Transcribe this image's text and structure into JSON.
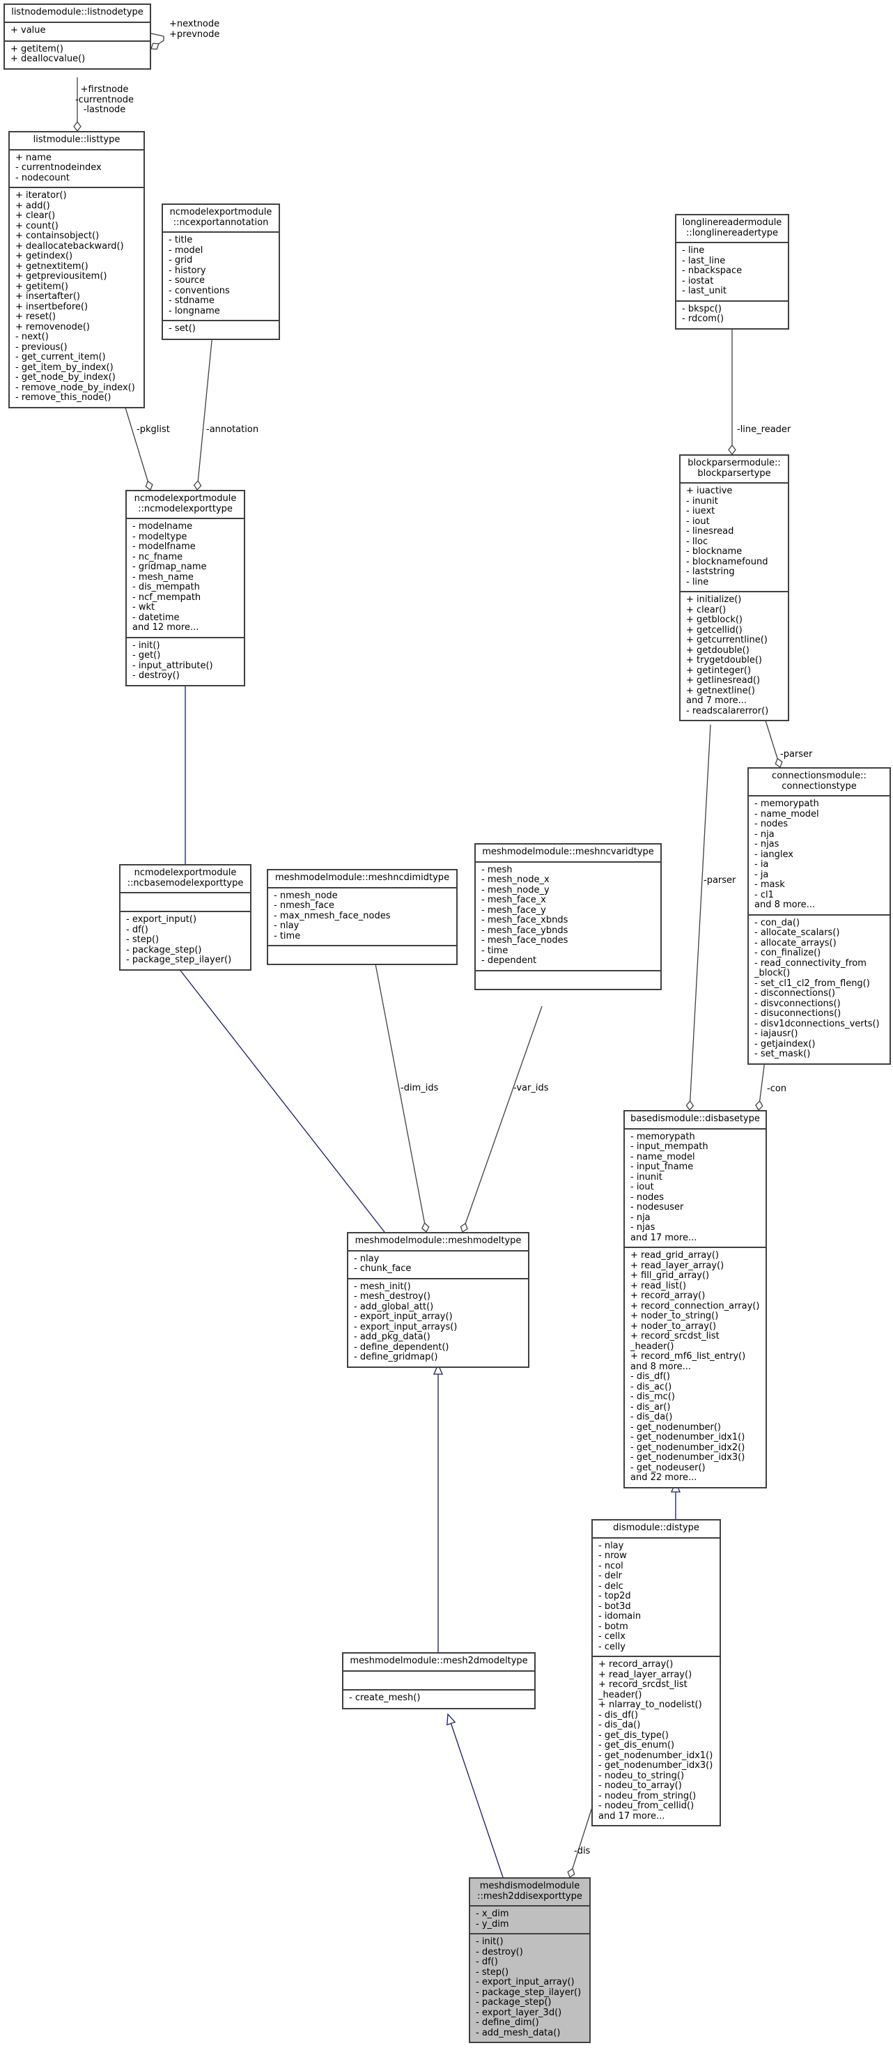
{
  "diagram": {
    "type": "uml-class-collaboration",
    "colors": {
      "association": "#404040",
      "inheritance": "#191970",
      "focus_fill": "#bfbfbf"
    },
    "classes": [
      {
        "id": "listnodetype",
        "title": "listnodemodule::listnodetype",
        "attributes": [
          "+ value"
        ],
        "methods": [
          "+ getitem()",
          "+ deallocvalue()"
        ]
      },
      {
        "id": "listtype",
        "title": "listmodule::listtype",
        "attributes": [
          "+ name",
          "- currentnodeindex",
          "- nodecount"
        ],
        "methods": [
          "+ iterator()",
          "+ add()",
          "+ clear()",
          "+ count()",
          "+ containsobject()",
          "+ deallocatebackward()",
          "+ getindex()",
          "+ getnextitem()",
          "+ getpreviousitem()",
          "+ getitem()",
          "+ insertafter()",
          "+ insertbefore()",
          "+ reset()",
          "+ removenode()",
          "- next()",
          "- previous()",
          "- get_current_item()",
          "- get_item_by_index()",
          "- get_node_by_index()",
          "- remove_node_by_index()",
          "- remove_this_node()"
        ]
      },
      {
        "id": "ncexportannotation",
        "title": "ncmodelexportmodule\n::ncexportannotation",
        "attributes": [
          "- title",
          "- model",
          "- grid",
          "- history",
          "- source",
          "- conventions",
          "- stdname",
          "- longname"
        ],
        "methods": [
          "- set()"
        ]
      },
      {
        "id": "longlinereadertype",
        "title": "longlinereadermodule\n::longlinereadertype",
        "attributes": [
          "- line",
          "- last_line",
          "- nbackspace",
          "- iostat",
          "- last_unit"
        ],
        "methods": [
          "- bkspc()",
          "- rdcom()"
        ]
      },
      {
        "id": "ncmodelexporttype",
        "title": "ncmodelexportmodule\n::ncmodelexporttype",
        "attributes": [
          "- modelname",
          "- modeltype",
          "- modelfname",
          "- nc_fname",
          "- gridmap_name",
          "- mesh_name",
          "- dis_mempath",
          "- ncf_mempath",
          "- wkt",
          "- datetime",
          "and 12 more..."
        ],
        "methods": [
          "- init()",
          "- get()",
          "- input_attribute()",
          "- destroy()"
        ]
      },
      {
        "id": "blockparsertype",
        "title": "blockparsermodule::\nblockparsertype",
        "attributes": [
          "+ iuactive",
          "- inunit",
          "- iuext",
          "- iout",
          "- linesread",
          "- lloc",
          "- blockname",
          "- blocknamefound",
          "- laststring",
          "- line"
        ],
        "methods": [
          "+ initialize()",
          "+ clear()",
          "+ getblock()",
          "+ getcellid()",
          "+ getcurrentline()",
          "+ getdouble()",
          "+ trygetdouble()",
          "+ getinteger()",
          "+ getlinesread()",
          "+ getnextline()",
          "and 7 more...",
          "- readscalarerror()"
        ]
      },
      {
        "id": "connectionstype",
        "title": "connectionsmodule::\nconnectionstype",
        "attributes": [
          "- memorypath",
          "- name_model",
          "- nodes",
          "- nja",
          "- njas",
          "- ianglex",
          "- ia",
          "- ja",
          "- mask",
          "- cl1",
          "and 8 more..."
        ],
        "methods": [
          "- con_da()",
          "- allocate_scalars()",
          "- allocate_arrays()",
          "- con_finalize()",
          "- read_connectivity_from\n_block()",
          "- set_cl1_cl2_from_fleng()",
          "- disconnections()",
          "- disvconnections()",
          "- disuconnections()",
          "- disv1dconnections_verts()",
          "- iajausr()",
          "- getjaindex()",
          "- set_mask()"
        ]
      },
      {
        "id": "ncbasemodelexporttype",
        "title": "ncmodelexportmodule\n::ncbasemodelexporttype",
        "attributes": [],
        "methods": [
          "- export_input()",
          "- df()",
          "- step()",
          "- package_step()",
          "- package_step_ilayer()"
        ]
      },
      {
        "id": "meshncdimidtype",
        "title": "meshmodelmodule::meshncdimidtype",
        "attributes": [
          "- nmesh_node",
          "- nmesh_face",
          "- max_nmesh_face_nodes",
          "- nlay",
          "- time"
        ],
        "methods": []
      },
      {
        "id": "meshncvaridtype",
        "title": "meshmodelmodule::meshncvaridtype",
        "attributes": [
          "- mesh",
          "- mesh_node_x",
          "- mesh_node_y",
          "- mesh_face_x",
          "- mesh_face_y",
          "- mesh_face_xbnds",
          "- mesh_face_ybnds",
          "- mesh_face_nodes",
          "- time",
          "- dependent"
        ],
        "methods": []
      },
      {
        "id": "disbasetype",
        "title": "basedismodule::disbasetype",
        "attributes": [
          "- memorypath",
          "- input_mempath",
          "- name_model",
          "- input_fname",
          "- inunit",
          "- iout",
          "- nodes",
          "- nodesuser",
          "- nja",
          "- njas",
          "and 17 more..."
        ],
        "methods": [
          "+ read_grid_array()",
          "+ read_layer_array()",
          "+ fill_grid_array()",
          "+ read_list()",
          "+ record_array()",
          "+ record_connection_array()",
          "+ noder_to_string()",
          "+ noder_to_array()",
          "+ record_srcdst_list\n_header()",
          "+ record_mf6_list_entry()",
          "and 8 more...",
          "- dis_df()",
          "- dis_ac()",
          "- dis_mc()",
          "- dis_ar()",
          "- dis_da()",
          "- get_nodenumber()",
          "- get_nodenumber_idx1()",
          "- get_nodenumber_idx2()",
          "- get_nodenumber_idx3()",
          "- get_nodeuser()",
          "and 22 more..."
        ]
      },
      {
        "id": "meshmodeltype",
        "title": "meshmodelmodule::meshmodeltype",
        "attributes": [
          "- nlay",
          "- chunk_face"
        ],
        "methods": [
          "- mesh_init()",
          "- mesh_destroy()",
          "- add_global_att()",
          "- export_input_array()",
          "- export_input_arrays()",
          "- add_pkg_data()",
          "- define_dependent()",
          "- define_gridmap()"
        ]
      },
      {
        "id": "distype",
        "title": "dismodule::distype",
        "attributes": [
          "- nlay",
          "- nrow",
          "- ncol",
          "- delr",
          "- delc",
          "- top2d",
          "- bot3d",
          "- idomain",
          "- botm",
          "- cellx",
          "- celly"
        ],
        "methods": [
          "+ record_array()",
          "+ read_layer_array()",
          "+ record_srcdst_list\n_header()",
          "+ nlarray_to_nodelist()",
          "- dis_df()",
          "- dis_da()",
          "- get_dis_type()",
          "- get_dis_enum()",
          "- get_nodenumber_idx1()",
          "- get_nodenumber_idx3()",
          "- nodeu_to_string()",
          "- nodeu_to_array()",
          "- nodeu_from_string()",
          "- nodeu_from_cellid()",
          "and 17 more..."
        ]
      },
      {
        "id": "mesh2dmodeltype",
        "title": "meshmodelmodule::mesh2dmodeltype",
        "attributes": [],
        "methods": [
          "- create_mesh()"
        ]
      },
      {
        "id": "mesh2ddisexporttype",
        "title": "meshdismodelmodule\n::mesh2ddisexporttype",
        "focus": true,
        "attributes": [
          "- x_dim",
          "- y_dim"
        ],
        "methods": [
          "- init()",
          "- destroy()",
          "- df()",
          "- step()",
          "- export_input_array()",
          "- package_step_ilayer()",
          "- package_step()",
          "- export_layer_3d()",
          "- define_dim()",
          "- add_mesh_data()"
        ]
      }
    ],
    "relations": [
      {
        "from": "listnodetype",
        "to": "listnodetype",
        "kind": "association",
        "label": "+nextnode\n+prevnode"
      },
      {
        "from": "listnodetype",
        "to": "listtype",
        "kind": "association",
        "label": "+firstnode\n-currentnode\n-lastnode"
      },
      {
        "from": "listtype",
        "to": "ncmodelexporttype",
        "kind": "association",
        "label": "-pkglist"
      },
      {
        "from": "ncexportannotation",
        "to": "ncmodelexporttype",
        "kind": "association",
        "label": "-annotation"
      },
      {
        "from": "longlinereadertype",
        "to": "blockparsertype",
        "kind": "association",
        "label": "-line_reader"
      },
      {
        "from": "ncmodelexporttype",
        "to": "ncbasemodelexporttype",
        "kind": "inheritance",
        "label": ""
      },
      {
        "from": "blockparsertype",
        "to": "connectionstype",
        "kind": "association",
        "label": "-parser"
      },
      {
        "from": "blockparsertype",
        "to": "disbasetype",
        "kind": "association",
        "label": "-parser"
      },
      {
        "from": "connectionstype",
        "to": "disbasetype",
        "kind": "association",
        "label": "-con"
      },
      {
        "from": "ncbasemodelexporttype",
        "to": "meshmodeltype",
        "kind": "inheritance",
        "label": ""
      },
      {
        "from": "meshncdimidtype",
        "to": "meshmodeltype",
        "kind": "association",
        "label": "-dim_ids"
      },
      {
        "from": "meshncvaridtype",
        "to": "meshmodeltype",
        "kind": "association",
        "label": "-var_ids"
      },
      {
        "from": "disbasetype",
        "to": "distype",
        "kind": "inheritance",
        "label": ""
      },
      {
        "from": "meshmodeltype",
        "to": "mesh2dmodeltype",
        "kind": "inheritance",
        "label": ""
      },
      {
        "from": "mesh2dmodeltype",
        "to": "mesh2ddisexporttype",
        "kind": "inheritance",
        "label": ""
      },
      {
        "from": "distype",
        "to": "mesh2ddisexporttype",
        "kind": "association",
        "label": "-dis"
      }
    ]
  }
}
